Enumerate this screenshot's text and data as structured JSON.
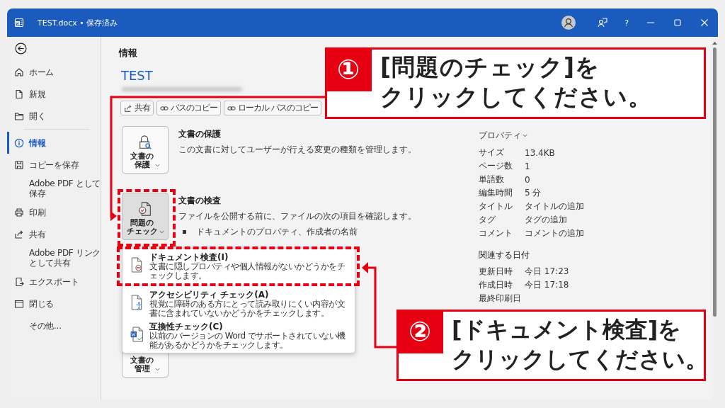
{
  "window": {
    "title": "TEST.docx • 保存済み",
    "help": "?"
  },
  "sidebar": {
    "items": [
      {
        "lines": [
          "ホーム"
        ],
        "kind": "home",
        "selected": false
      },
      {
        "lines": [
          "新規"
        ],
        "kind": "new",
        "selected": false
      },
      {
        "lines": [
          "開く"
        ],
        "kind": "open",
        "selected": false
      },
      {
        "lines": [
          "情報"
        ],
        "kind": "info",
        "selected": true
      },
      {
        "lines": [
          "コピーを保存"
        ],
        "kind": "save",
        "selected": false
      },
      {
        "lines": [
          "Adobe PDF として",
          "保存"
        ],
        "kind": "plain",
        "selected": false
      },
      {
        "lines": [
          "印刷"
        ],
        "kind": "print",
        "selected": false
      },
      {
        "lines": [
          "共有"
        ],
        "kind": "share",
        "selected": false
      },
      {
        "lines": [
          "Adobe PDF リンク",
          "として共有"
        ],
        "kind": "plain",
        "selected": false
      },
      {
        "lines": [
          "エクスポート"
        ],
        "kind": "export",
        "selected": false
      },
      {
        "lines": [
          "閉じる"
        ],
        "kind": "close",
        "selected": false
      },
      {
        "lines": [
          "その他..."
        ],
        "kind": "plain",
        "selected": false
      }
    ]
  },
  "info": {
    "heading": "情報",
    "doc_title": "TEST",
    "actions": [
      {
        "label": "共有",
        "kind": "share"
      },
      {
        "label": "パスのコピー",
        "kind": "link"
      },
      {
        "label": "ローカル パスのコピー",
        "kind": "link"
      }
    ],
    "sections": [
      {
        "button": [
          "文書の",
          "保護"
        ],
        "kind": "protect",
        "selected": false,
        "heading": "文書の保護",
        "description": "この文書に対してユーザーが行える変更の種類を管理します。"
      },
      {
        "button": [
          "問題の",
          "チェック"
        ],
        "kind": "inspect",
        "selected": true,
        "heading": "文書の検査",
        "description": "ファイルを公開する前に、ファイルの次の項目を確認します。",
        "bullets": [
          "ドキュメントのプロパティ、作成者の名前"
        ]
      },
      {
        "kind": "hidden"
      },
      {
        "button": [
          "文書の",
          "管理"
        ],
        "kind": "manage",
        "selected": false
      }
    ]
  },
  "menu": {
    "items": [
      {
        "title": "ドキュメント検査(I)",
        "description": "文書に隠しプロパティや個人情報がないかどうかをチェックします。",
        "kind": "inspect"
      },
      {
        "title": "アクセシビリティ チェック(A)",
        "description": "視覚に障碍のある方にとって読み取りにくい内容が文書に含まれていないかどうかをチェックします。",
        "kind": "access"
      },
      {
        "title": "互換性チェック(C)",
        "description": "以前のバージョンの Word でサポートされていない機能があるかどうかをチェックします。",
        "kind": "compat"
      }
    ]
  },
  "properties": {
    "heading": "プロパティ",
    "rows": [
      {
        "label": "サイズ",
        "value": "13.4KB"
      },
      {
        "label": "ページ数",
        "value": "1"
      },
      {
        "label": "単語数",
        "value": "0"
      },
      {
        "label": "編集時間",
        "value": "5 分"
      },
      {
        "label": "タイトル",
        "value": "タイトルの追加"
      },
      {
        "label": "タグ",
        "value": "タグの追加"
      },
      {
        "label": "コメント",
        "value": "コメントの追加"
      }
    ]
  },
  "dates": {
    "heading": "関連する日付",
    "rows": [
      {
        "label": "更新日時",
        "value": "今日 17:23"
      },
      {
        "label": "作成日時",
        "value": "今日 17:18"
      },
      {
        "label": "最終印刷日"
      }
    ]
  },
  "callouts": [
    {
      "number": "①",
      "lines": [
        "[問題のチェック]を",
        "クリックしてください。"
      ]
    },
    {
      "number": "②",
      "lines": [
        "[ドキュメント検査]を",
        "クリックしてください。"
      ]
    }
  ]
}
